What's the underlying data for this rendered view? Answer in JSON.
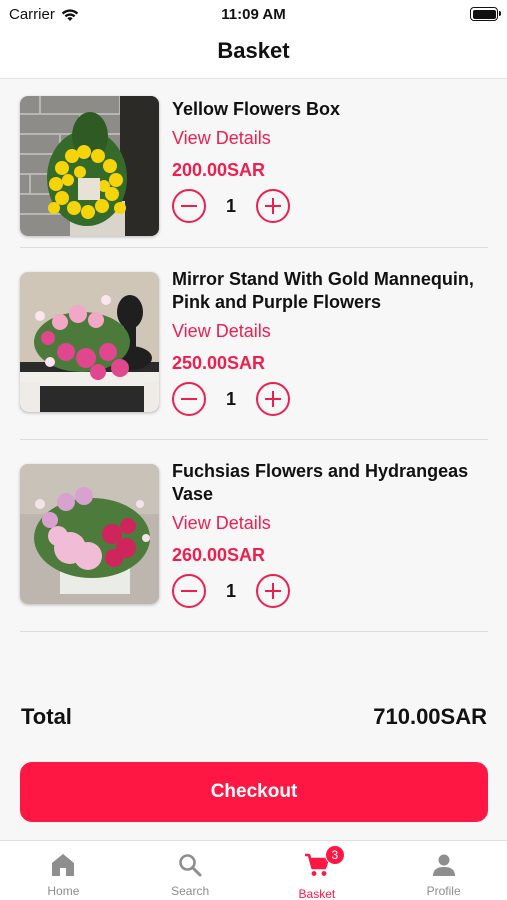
{
  "status_bar": {
    "carrier": "Carrier",
    "time": "11:09 AM"
  },
  "header": {
    "title": "Basket"
  },
  "items": [
    {
      "name": "Yellow Flowers Box",
      "details_label": "View Details",
      "price": "200.00SAR",
      "quantity": "1"
    },
    {
      "name": "Mirror Stand With Gold Mannequin, Pink and Purple Flowers",
      "details_label": "View Details",
      "price": "250.00SAR",
      "quantity": "1"
    },
    {
      "name": "Fuchsias Flowers and Hydrangeas Vase",
      "details_label": "View Details",
      "price": "260.00SAR",
      "quantity": "1"
    }
  ],
  "summary": {
    "total_label": "Total",
    "total_value": "710.00SAR"
  },
  "checkout": {
    "label": "Checkout"
  },
  "tabs": [
    {
      "label": "Home",
      "icon": "home-icon",
      "active": false
    },
    {
      "label": "Search",
      "icon": "search-icon",
      "active": false
    },
    {
      "label": "Basket",
      "icon": "cart-icon",
      "active": true,
      "badge": "3"
    },
    {
      "label": "Profile",
      "icon": "profile-icon",
      "active": false
    }
  ],
  "colors": {
    "accent": "#ff1744",
    "text": "#111111",
    "muted": "#8e8e8e",
    "background": "#f7f7f7"
  }
}
